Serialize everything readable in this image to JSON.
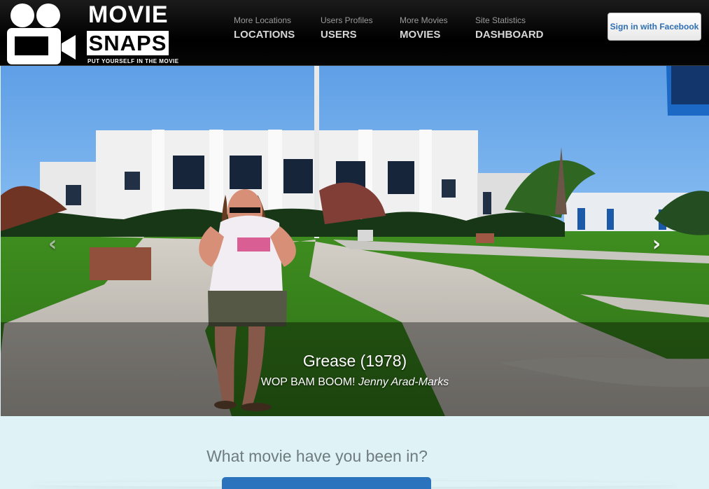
{
  "header": {
    "logo": {
      "word_top": "MOVIE",
      "word_bottom": "SNAPS",
      "tagline": "PUT YOURSELF IN THE MOVIE",
      "icon": "film-camera-icon"
    },
    "nav": [
      {
        "small": "More Locations",
        "label": "LOCATIONS"
      },
      {
        "small": "Users Profiles",
        "label": "USERS"
      },
      {
        "small": "More Movies",
        "label": "MOVIES"
      },
      {
        "small": "Site Statistics",
        "label": "DASHBOARD"
      }
    ],
    "facebook_button": "Sign in with Facebook"
  },
  "carousel": {
    "movie_title": "Grease (1978)",
    "quote": "WOP BAM BOOM!",
    "author": "Jenny Arad-Marks",
    "prev_icon": "chevron-left-icon",
    "next_icon": "chevron-right-icon",
    "prev_glyph": "‹",
    "next_glyph": "›"
  },
  "hero": {
    "question": "What movie have you been in?",
    "button_label": ""
  },
  "colors": {
    "navbar": "#000000",
    "facebook_text": "#2f6fb4",
    "hero_background": "#dff3f7",
    "cta_blue": "#2b73bc"
  }
}
